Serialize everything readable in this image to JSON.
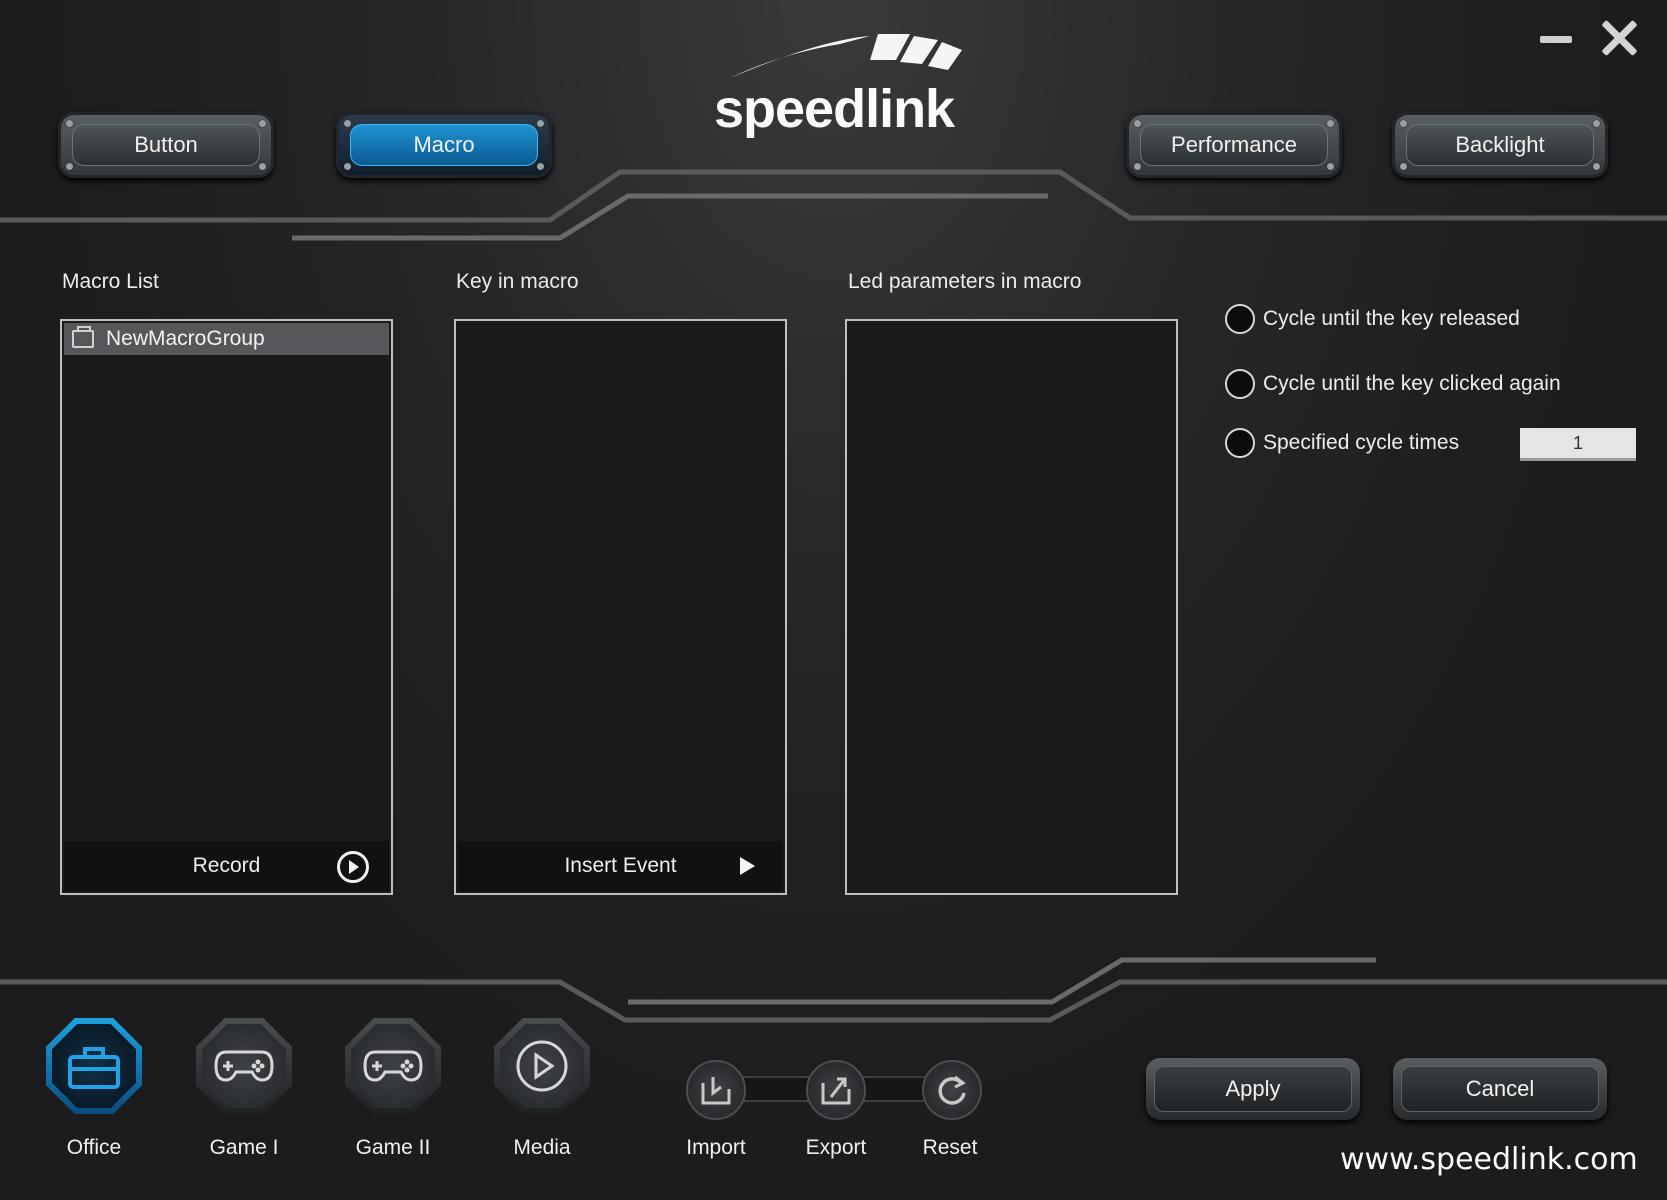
{
  "window": {
    "minimize_icon": "minimize-icon",
    "close_icon": "close-icon"
  },
  "logo": {
    "text": "speedlink"
  },
  "nav": {
    "button": "Button",
    "macro": "Macro",
    "performance": "Performance",
    "backlight": "Backlight",
    "active": "Macro",
    "active_color": "#1a8fd0"
  },
  "macro_list": {
    "title": "Macro List",
    "items": [
      {
        "label": "NewMacroGroup"
      }
    ],
    "footer_label": "Record"
  },
  "key_in_macro": {
    "title": "Key in macro",
    "footer_label": "Insert Event"
  },
  "led_params": {
    "title": "Led parameters in macro"
  },
  "cycle_options": {
    "until_released": "Cycle until the key released",
    "until_clicked": "Cycle until the key clicked again",
    "specified": "Specified cycle times",
    "times_value": "1"
  },
  "profiles": [
    {
      "label": "Office",
      "icon": "toolbox-icon",
      "active": true
    },
    {
      "label": "Game I",
      "icon": "gamepad-icon"
    },
    {
      "label": "Game II",
      "icon": "gamepad-icon"
    },
    {
      "label": "Media",
      "icon": "play-icon"
    }
  ],
  "file_actions": {
    "import": "Import",
    "export": "Export",
    "reset": "Reset"
  },
  "actions": {
    "apply": "Apply",
    "cancel": "Cancel"
  },
  "footer": {
    "website": "www.speedlink.com"
  }
}
